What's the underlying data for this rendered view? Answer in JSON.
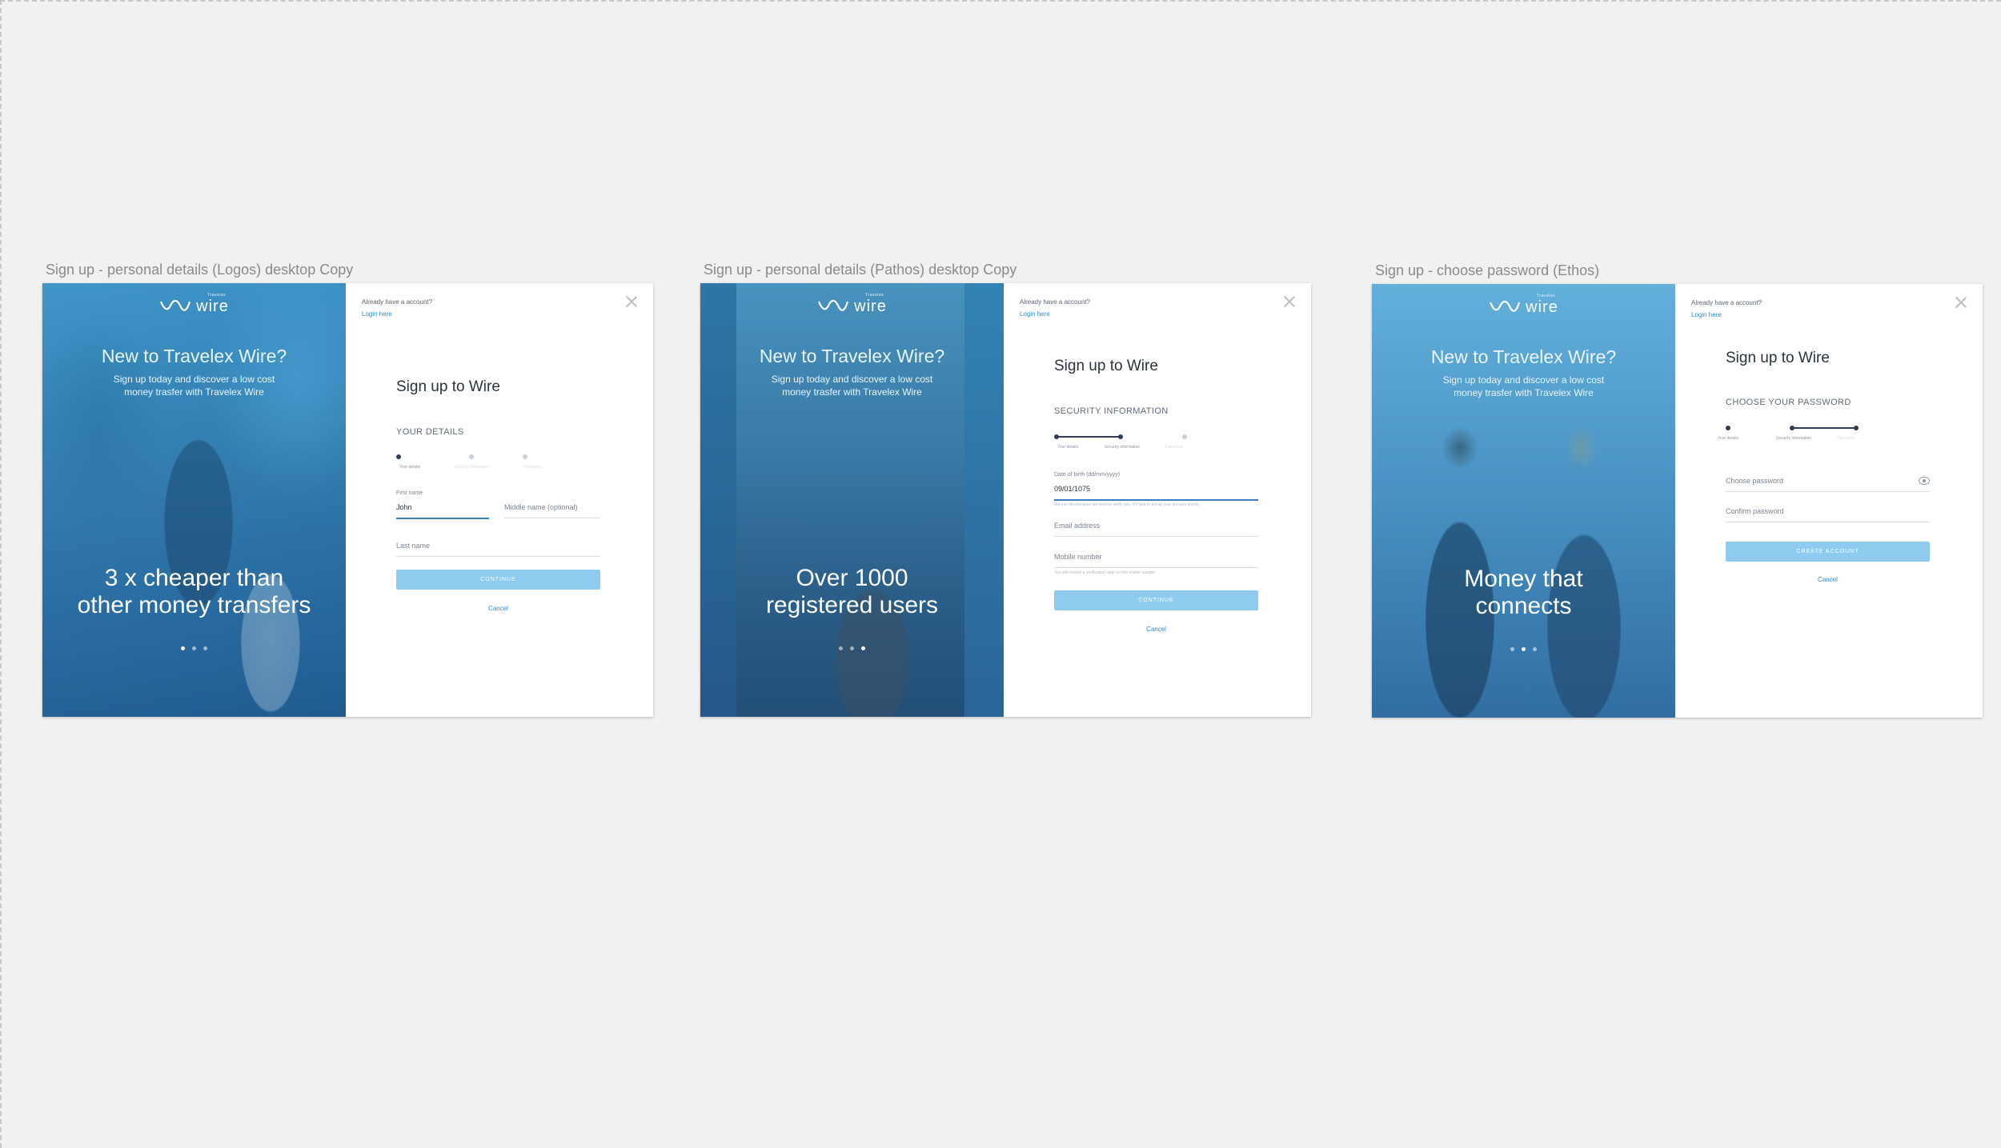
{
  "artboards": [
    {
      "label": "Sign up - personal details (Logos) desktop Copy",
      "logo": {
        "small": "Travelex",
        "text": "wire"
      },
      "hero": {
        "title": "New to Travelex Wire?",
        "subtitle": "Sign up today and discover a low cost money trasfer with Travelex Wire",
        "claim_line1": "3 x cheaper than",
        "claim_line2": "other money transfers",
        "active_dot": 1
      },
      "panel": {
        "have_account": "Already have a account?",
        "login": "Login here",
        "title": "Sign up to Wire",
        "section": "YOUR DETAILS",
        "steps": [
          "Your details",
          "Security information",
          "Password"
        ],
        "first_name_label": "First name",
        "first_name_value": "John",
        "middle_name_placeholder": "Middle name (optional)",
        "last_name_placeholder": "Last name",
        "cta": "CONTINUE",
        "cancel": "Cancel"
      }
    },
    {
      "label": "Sign up - personal details (Pathos) desktop Copy",
      "logo": {
        "small": "Travelex",
        "text": "wire"
      },
      "hero": {
        "title": "New to Travelex Wire?",
        "subtitle": "Sign up today and discover a low cost money trasfer with Travelex Wire",
        "claim_line1": "Over 1000",
        "claim_line2": "registered users",
        "active_dot": 3
      },
      "panel": {
        "have_account": "Already have a account?",
        "login": "Login here",
        "title": "Sign up to Wire",
        "section": "SECURITY INFORMATION",
        "steps": [
          "Your details",
          "Security information",
          "Password"
        ],
        "dob_label": "Date of birth (dd/mm/yyyy)",
        "dob_value": "09/01/1075",
        "dob_hint": "We use this because we need to verify you. It'll help to set up your account quickly.",
        "email_placeholder": "Email address",
        "mobile_placeholder": "Mobile number",
        "mobile_hint": "You will receive a verification code on this mobile number",
        "cta": "CONTINUE",
        "cancel": "Cancel"
      }
    },
    {
      "label": "Sign up - choose password (Ethos)",
      "logo": {
        "small": "Travelex",
        "text": "wire"
      },
      "hero": {
        "title": "New to Travelex Wire?",
        "subtitle": "Sign up today and discover a low cost money trasfer with Travelex Wire",
        "claim_line1": "Money that",
        "claim_line2": "connects",
        "active_dot": 2
      },
      "panel": {
        "have_account": "Already have a account?",
        "login": "Login here",
        "title": "Sign up to Wire",
        "section": "CHOOSE YOUR PASSWORD",
        "steps": [
          "Your details",
          "Security information",
          "Password"
        ],
        "password_placeholder": "Choose password",
        "confirm_placeholder": "Confirm password",
        "cta": "CREATE ACCOUNT",
        "cancel": "Cancel"
      }
    }
  ],
  "colors": {
    "accent": "#2b8ad6",
    "button": "#8ecbee",
    "dark_step": "#2e3c56",
    "canvas": "#f1f1f1"
  }
}
